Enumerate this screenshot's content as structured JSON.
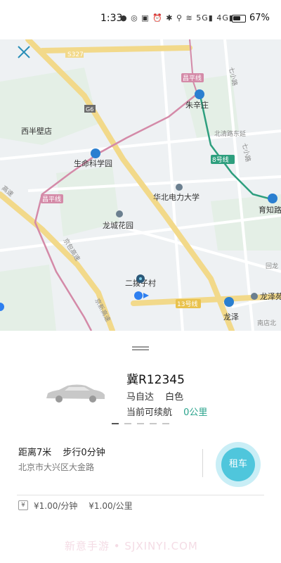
{
  "status_bar": {
    "time": "1:33",
    "icons_text": "● ◎  ▣ ⏰ ✱ ⚲ ≋ 5G▮ 4G▮",
    "battery_level": 0.67,
    "battery_text": "67%"
  },
  "map": {
    "place_labels": {
      "xibanbidian": "西半壁店",
      "shengming": "生命科学园",
      "huabei": "华北电力大学",
      "longcheng": "龙城花园",
      "zhuxinzhuang": "朱辛庄",
      "yuzhi": "育知路",
      "longze": "龙泽",
      "longze_yuan": "龙泽苑",
      "erbozicun": "二拨子村"
    },
    "road_labels": {
      "s327": "S327",
      "g6": "G6",
      "changping_top": "昌平线",
      "changping_left": "昌平线",
      "line8": "8号线",
      "line13": "13号线",
      "qixiaolu_top": "七小路",
      "qixiaolu_mid": "七小路",
      "beiqinglu": "北清路东延",
      "jingbao": "京包高速",
      "jingxin": "京新高速",
      "gaosu_left": "高速",
      "huilonguan": "回龙",
      "nandian": "南店北"
    }
  },
  "car": {
    "plate": "冀R12345",
    "brand": "马自达",
    "color": "白色",
    "range_label": "当前可续航",
    "range_value": "0公里"
  },
  "location": {
    "distance": "距离7米",
    "walk": "步行0分钟",
    "address": "北京市大兴区大金路"
  },
  "actions": {
    "rent_label": "租车"
  },
  "pricing": {
    "icon_glyph": "¥",
    "per_minute": "¥1.00/分钟",
    "per_km": "¥1.00/公里"
  },
  "watermark": "新意手游 • SJXINYI.COM",
  "colors": {
    "accent": "#4fc6dc",
    "accent_halo": "#c9eef6",
    "range_green": "#2aa38c",
    "subway_pink": "#d48aa8",
    "subway_green": "#2e9f7e",
    "highway_yellow": "#f2d98a"
  }
}
